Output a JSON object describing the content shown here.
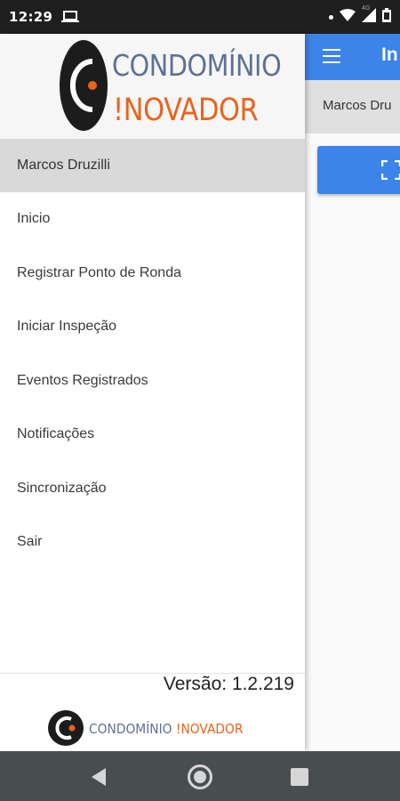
{
  "status_bar": {
    "time": "12:29",
    "network_label": "4G"
  },
  "app": {
    "title": "In",
    "user_name": "Marcos Dru"
  },
  "drawer": {
    "logo": {
      "top_text": "CONDOMÍNIO",
      "bottom_text": "!NOVADOR"
    },
    "user_name": "Marcos Druzilli",
    "menu": [
      "Inicio",
      "Registrar Ponto de Ronda",
      "Iniciar Inspeção",
      "Eventos Registrados",
      "Notificações",
      "Sincronização",
      "Sair"
    ],
    "version": "Versão: 1.2.219",
    "footer_logo": {
      "text_a": "CONDOMÍNIO ",
      "text_b": "!NOVADOR"
    }
  },
  "colors": {
    "primary": "#3c84e8",
    "logo_blue": "#5e7194",
    "logo_orange": "#e8641e",
    "status_bar": "#1f1f1f",
    "nav_bar": "#484d50"
  }
}
